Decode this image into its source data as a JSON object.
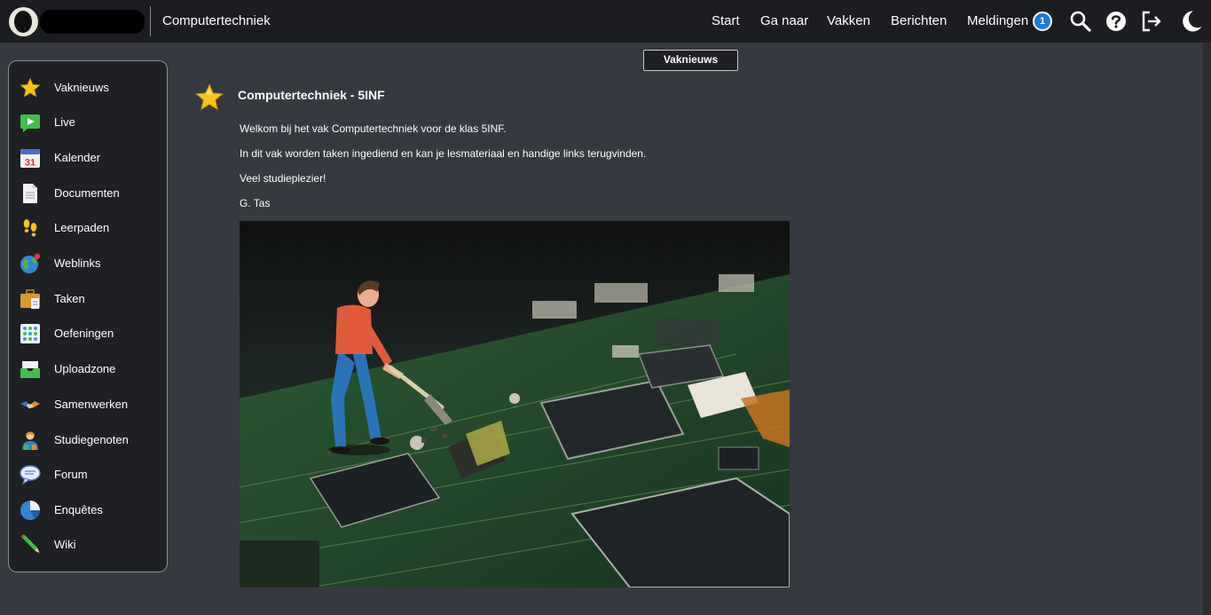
{
  "topbar": {
    "course": "Computertechniek",
    "nav": [
      "Start",
      "Ga naar",
      "Vakken",
      "Berichten",
      "Meldingen"
    ],
    "notification_count": "1",
    "icons": [
      "search-icon",
      "help-icon",
      "logout-icon",
      "dark-mode-icon"
    ]
  },
  "sidebar": {
    "items": [
      {
        "label": "Vaknieuws",
        "icon": "star-icon"
      },
      {
        "label": "Live",
        "icon": "live-play-icon"
      },
      {
        "label": "Kalender",
        "icon": "calendar-icon",
        "icon_text": "31"
      },
      {
        "label": "Documenten",
        "icon": "document-icon"
      },
      {
        "label": "Leerpaden",
        "icon": "footsteps-icon"
      },
      {
        "label": "Weblinks",
        "icon": "globe-icon"
      },
      {
        "label": "Taken",
        "icon": "briefcase-icon"
      },
      {
        "label": "Oefeningen",
        "icon": "exercises-grid-icon"
      },
      {
        "label": "Uploadzone",
        "icon": "upload-tray-icon"
      },
      {
        "label": "Samenwerken",
        "icon": "handshake-icon"
      },
      {
        "label": "Studiegenoten",
        "icon": "classmates-icon"
      },
      {
        "label": "Forum",
        "icon": "speech-bubble-icon"
      },
      {
        "label": "Enquêtes",
        "icon": "pie-chart-icon"
      },
      {
        "label": "Wiki",
        "icon": "pencil-icon"
      }
    ]
  },
  "main": {
    "section_button": "Vaknieuws",
    "post": {
      "title": "Computertechniek - 5INF",
      "paragraphs": [
        "Welkom bij het vak Computertechniek voor de klas 5INF.",
        "In dit vak worden taken ingediend en kan je lesmateriaal en handige links terugvinden.",
        "Veel studieplezier!",
        "G. Tas"
      ],
      "image": "miniature-worker-on-circuit-board-photo"
    }
  },
  "colors": {
    "topbar": "#1c1d21",
    "background": "#36393f",
    "sidebar": "#1f2023",
    "badge": "#1a7ad9",
    "star": "#f5c518"
  }
}
